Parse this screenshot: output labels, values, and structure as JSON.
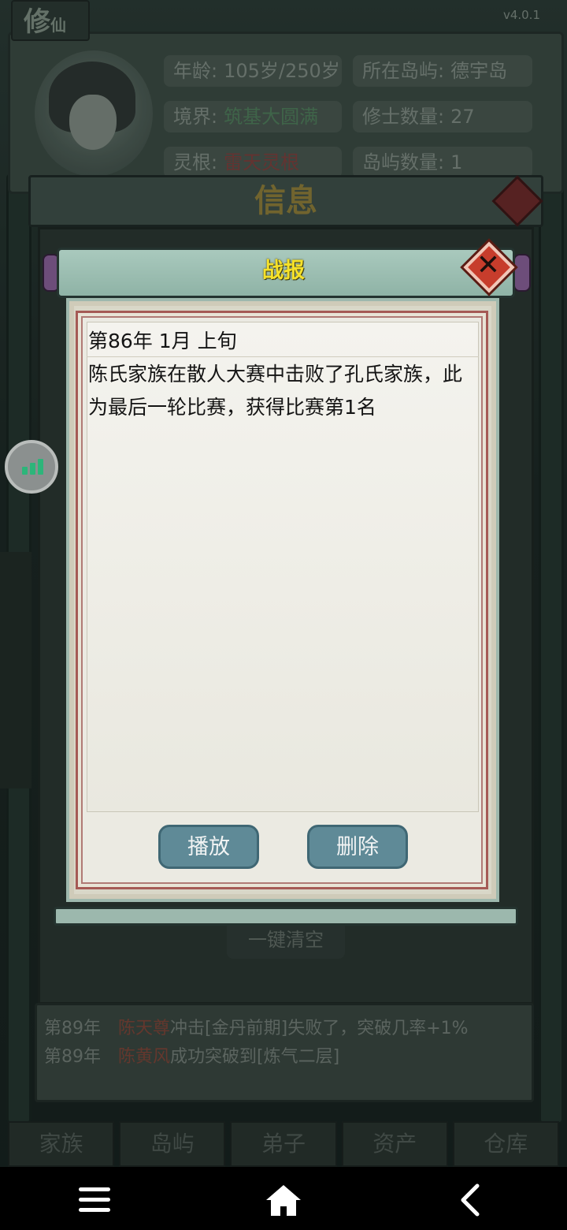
{
  "app": {
    "logo": "修",
    "logo_small": "仙",
    "version": "v4.0.1"
  },
  "stats": {
    "age_label": "年龄:",
    "age_value": "105岁/250岁",
    "island_label": "所在岛屿:",
    "island_value": "德宇岛",
    "realm_label": "境界:",
    "realm_value": "筑基大圆满",
    "cultivators_label": "修士数量:",
    "cultivators_value": "27",
    "root_label": "灵根:",
    "root_value": "雷天灵根",
    "islands_label": "岛屿数量:",
    "islands_value": "1"
  },
  "info_banner": "信息",
  "background_clear_button": "一键清空",
  "logs": [
    {
      "year": "第89年",
      "name": "陈天尊",
      "text": "冲击[金丹前期]失败了，突破几率+1%"
    },
    {
      "year": "第89年",
      "name": "陈黄风",
      "text": "成功突破到[炼气二层]"
    }
  ],
  "tabs": [
    "家族",
    "岛屿",
    "弟子",
    "资产",
    "仓库"
  ],
  "dialog": {
    "title": "战报",
    "report_date": "第86年 1月 上旬",
    "report_body": "陈氏家族在散人大赛中击败了孔氏家族，此为最后一轮比赛，获得比赛第1名",
    "play_button": "播放",
    "delete_button": "删除"
  },
  "icons": {
    "close": "close-icon",
    "floating": "signal-bars-icon",
    "nav_menu": "menu-icon",
    "nav_home": "home-icon",
    "nav_back": "back-icon"
  },
  "colors": {
    "title_yellow": "#f5e12a",
    "button_teal": "#5f8a97",
    "close_red": "#c73d2c",
    "signal_green": "#2db57a"
  }
}
